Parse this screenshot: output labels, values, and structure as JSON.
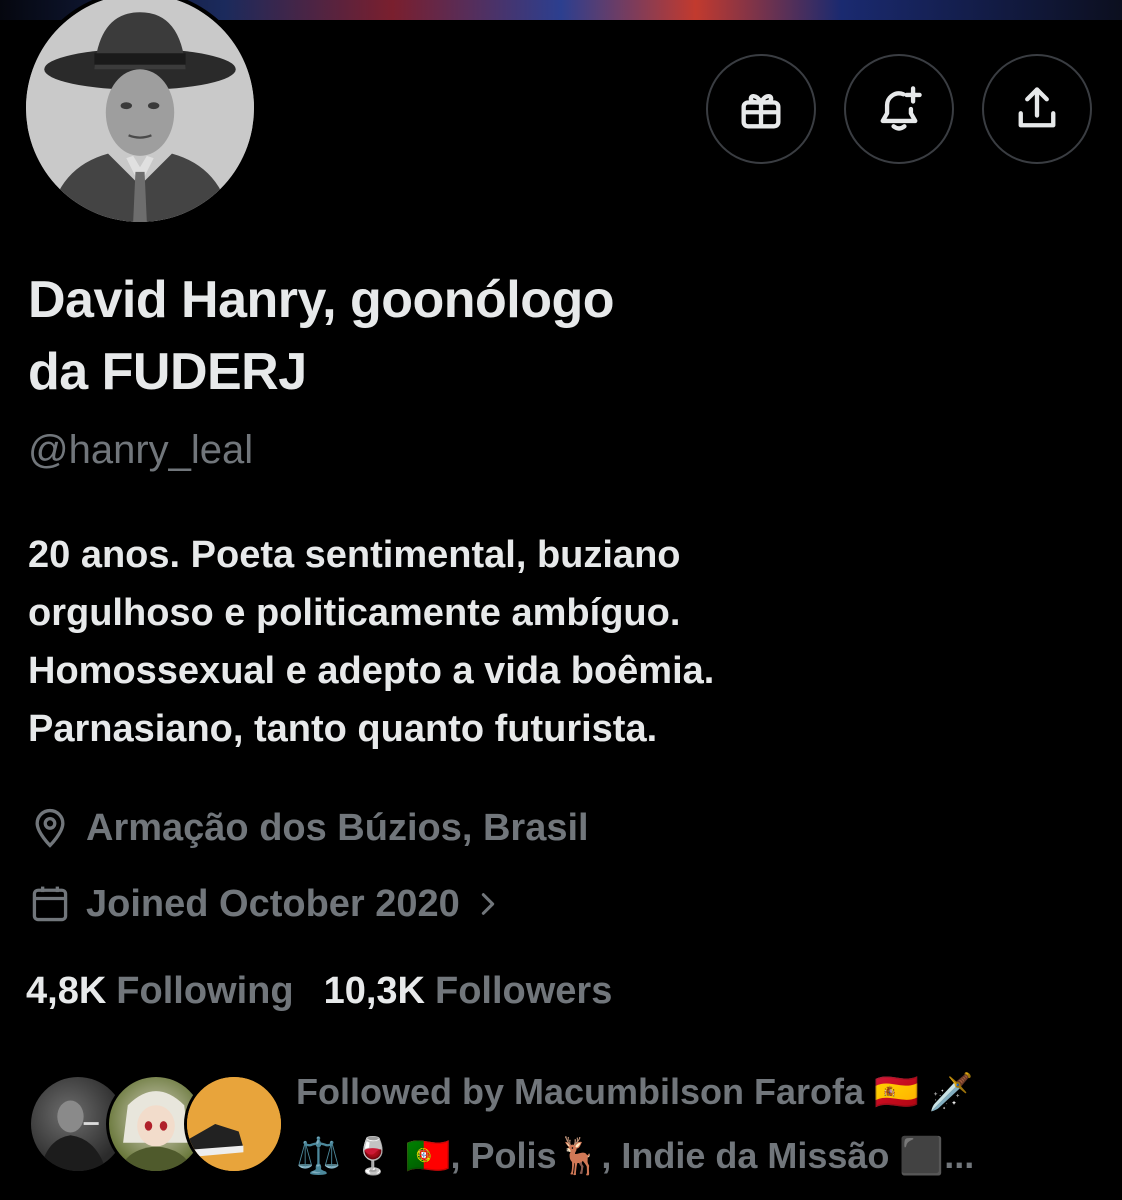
{
  "profile": {
    "name_line1": "David Hanry, goonólogo",
    "name_line2": "da FUDERJ",
    "handle": "@hanry_leal",
    "bio_lines": [
      "20 anos. Poeta sentimental, buziano",
      "orgulhoso e politicamente ambíguo.",
      "Homossexual e adepto a vida boêmia.",
      "Parnasiano, tanto quanto futurista."
    ],
    "location": "Armação dos Búzios, Brasil",
    "joined": "Joined October 2020"
  },
  "actions": {
    "gift_icon": "gift-icon",
    "notify_icon": "bell-plus-icon",
    "share_icon": "share-icon"
  },
  "stats": {
    "following_count": "4,8K",
    "following_label": "Following",
    "followers_count": "10,3K",
    "followers_label": "Followers"
  },
  "followed_by": {
    "line1": "Followed by Macumbilson Farofa 🇪🇸 🗡️",
    "line2": "⚖️ 🍷 🇵🇹, Polis🦌, Indie da Missão ⬛..."
  },
  "colors": {
    "background": "#000000",
    "primary_text": "#e7e9ea",
    "secondary_text": "#71767b",
    "button_border": "#3a3d42"
  }
}
